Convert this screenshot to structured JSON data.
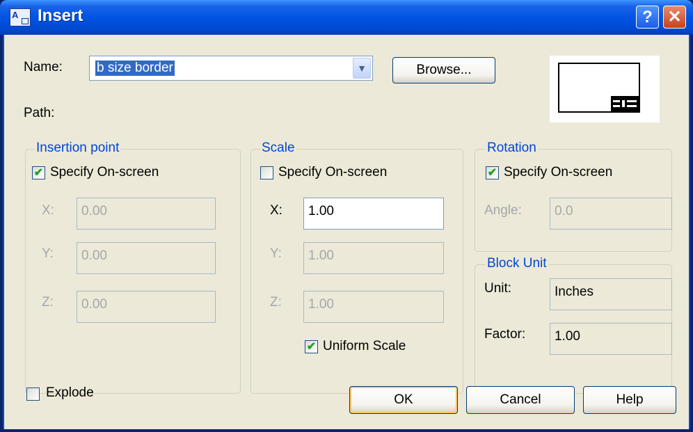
{
  "window": {
    "title": "Insert",
    "help_glyph": "?",
    "close_glyph": "✕"
  },
  "name": {
    "label": "Name:",
    "value": "b size border",
    "browse": "Browse..."
  },
  "path": {
    "label": "Path:"
  },
  "insertion_point": {
    "title": "Insertion point",
    "specify_label": "Specify On-screen",
    "specify_checked": true,
    "x_label": "X:",
    "x_value": "0.00",
    "y_label": "Y:",
    "y_value": "0.00",
    "z_label": "Z:",
    "z_value": "0.00"
  },
  "scale": {
    "title": "Scale",
    "specify_label": "Specify On-screen",
    "specify_checked": false,
    "x_label": "X:",
    "x_value": "1.00",
    "y_label": "Y:",
    "y_value": "1.00",
    "z_label": "Z:",
    "z_value": "1.00",
    "uniform_label": "Uniform Scale",
    "uniform_checked": true
  },
  "rotation": {
    "title": "Rotation",
    "specify_label": "Specify On-screen",
    "specify_checked": true,
    "angle_label": "Angle:",
    "angle_value": "0.0"
  },
  "block_unit": {
    "title": "Block Unit",
    "unit_label": "Unit:",
    "unit_value": "Inches",
    "factor_label": "Factor:",
    "factor_value": "1.00"
  },
  "explode": {
    "label": "Explode",
    "checked": false
  },
  "buttons": {
    "ok": "OK",
    "cancel": "Cancel",
    "help": "Help"
  },
  "glyphs": {
    "check": "✔",
    "dropdown": "▼"
  },
  "colors": {
    "titlebar": "#0054e3",
    "group_title": "#0046d5",
    "dialog_bg": "#ece9d8",
    "selection": "#316ac5"
  }
}
